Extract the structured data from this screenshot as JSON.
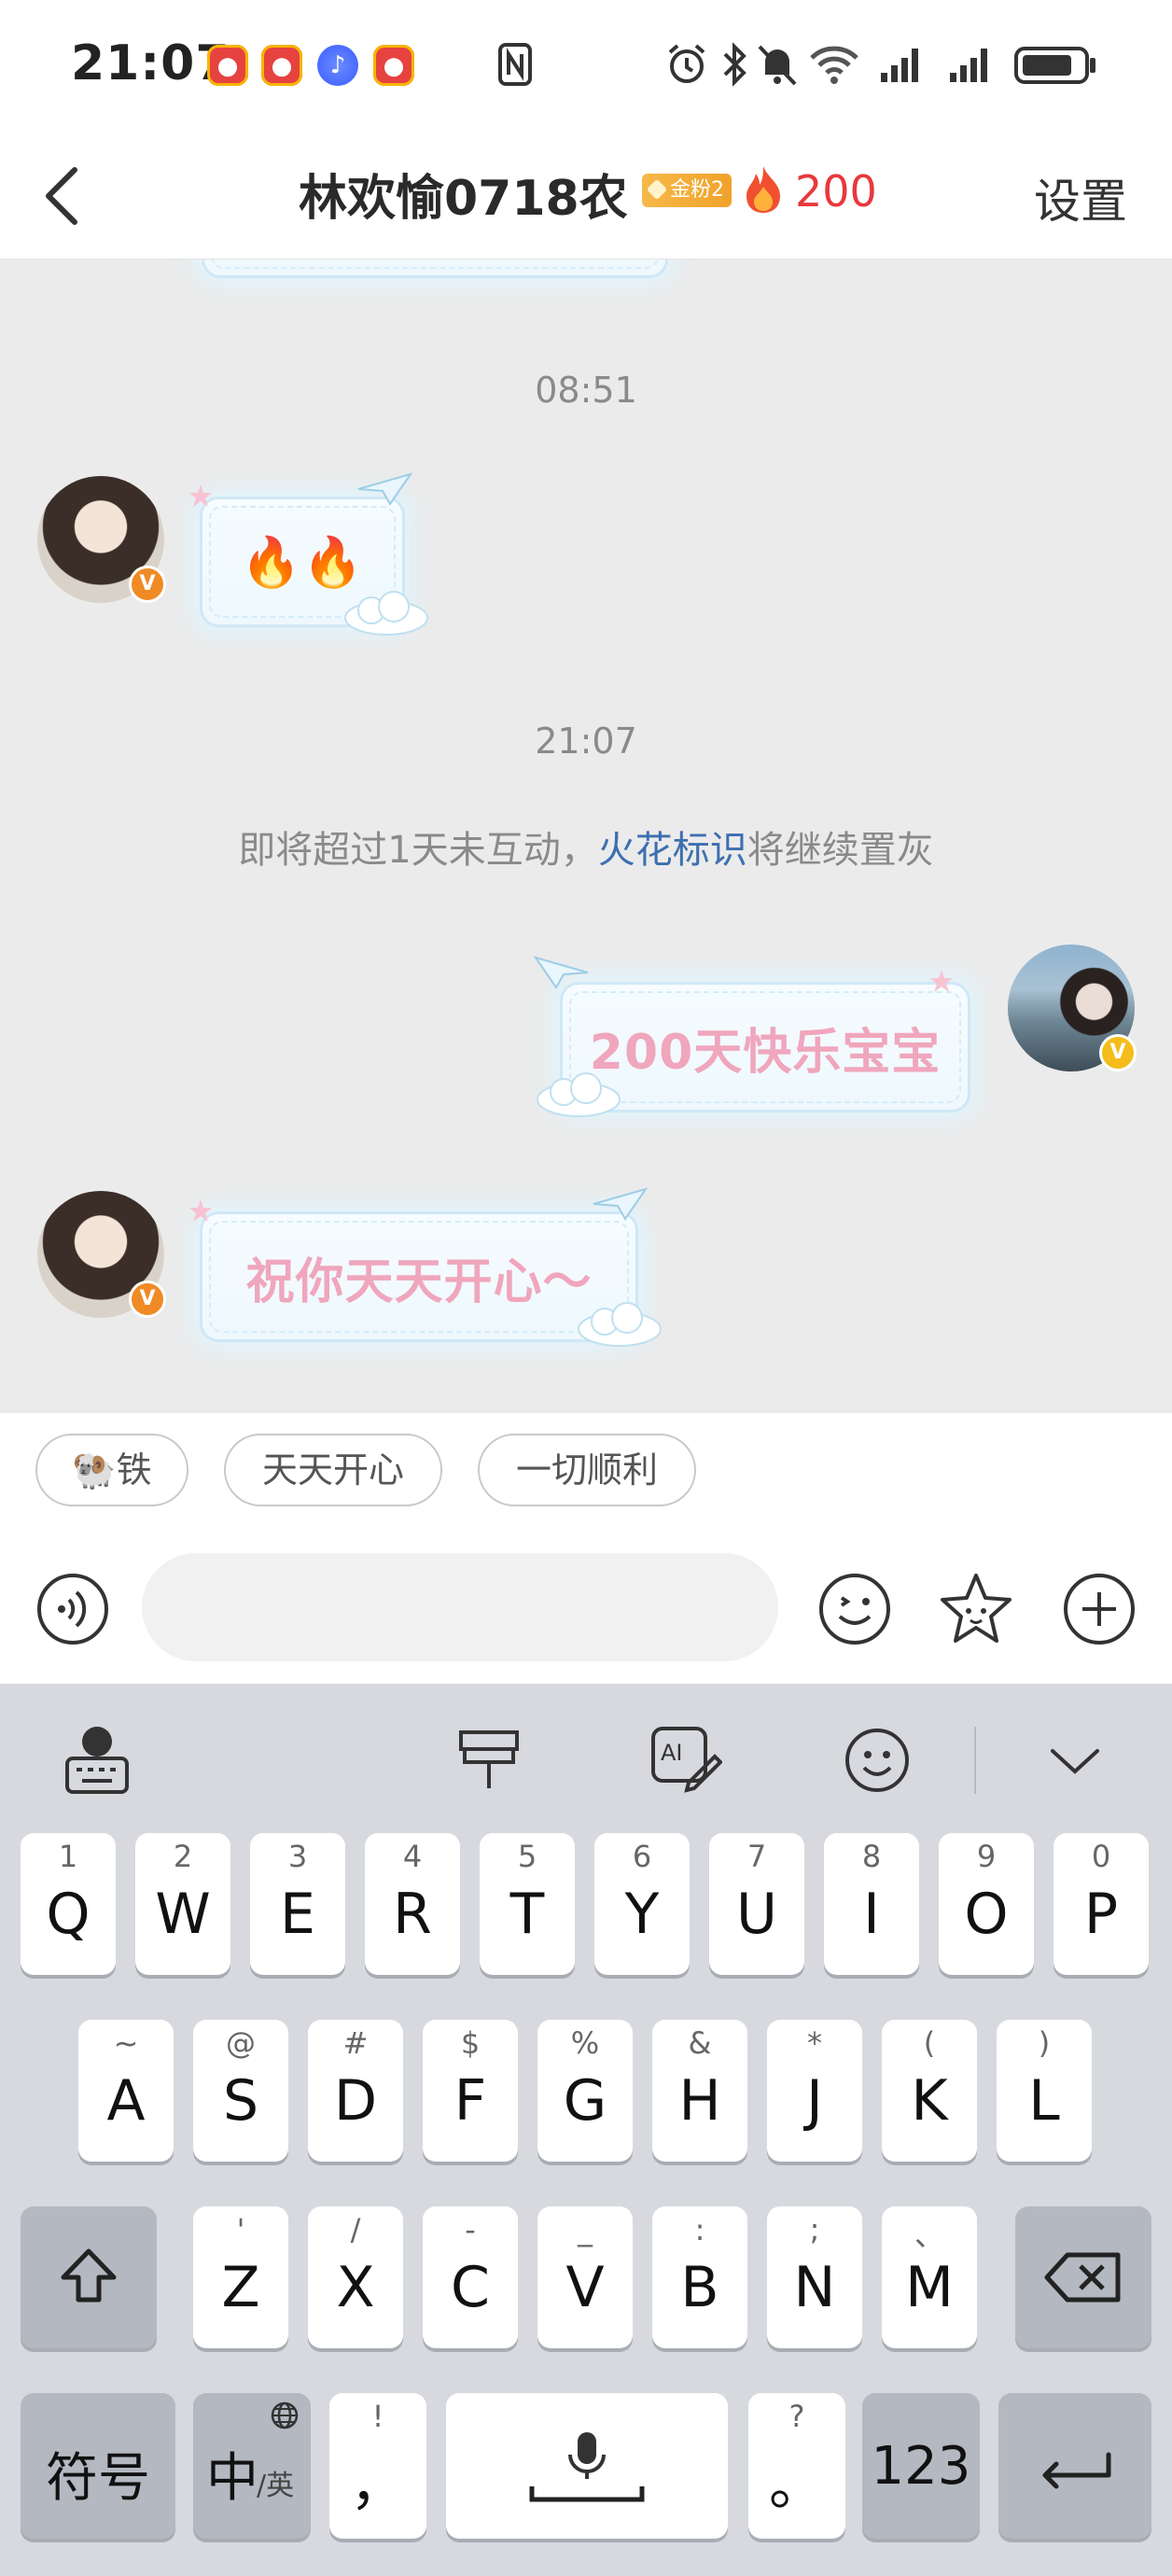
{
  "status_bar": {
    "time": "21:07"
  },
  "header": {
    "title": "林欢愉0718农",
    "fan_badge": "金粉2",
    "spark_count": "200",
    "settings": "设置"
  },
  "chat": {
    "timestamp_1": "08:51",
    "msg_1": "🔥🔥",
    "timestamp_2": "21:07",
    "system_note_prefix": "即将超过1天未互动，",
    "system_note_link": "火花标识",
    "system_note_suffix": "将继续置灰",
    "msg_2": "200天快乐宝宝",
    "msg_3": "祝你天天开心～"
  },
  "quick_replies": [
    "🐏铁",
    "天天开心",
    "一切顺利"
  ],
  "input": {
    "value": "",
    "placeholder": ""
  },
  "keyboard": {
    "row1": [
      {
        "main": "Q",
        "sub": "1"
      },
      {
        "main": "W",
        "sub": "2"
      },
      {
        "main": "E",
        "sub": "3"
      },
      {
        "main": "R",
        "sub": "4"
      },
      {
        "main": "T",
        "sub": "5"
      },
      {
        "main": "Y",
        "sub": "6"
      },
      {
        "main": "U",
        "sub": "7"
      },
      {
        "main": "I",
        "sub": "8"
      },
      {
        "main": "O",
        "sub": "9"
      },
      {
        "main": "P",
        "sub": "0"
      }
    ],
    "row2": [
      {
        "main": "A",
        "sub": "~"
      },
      {
        "main": "S",
        "sub": "@"
      },
      {
        "main": "D",
        "sub": "#"
      },
      {
        "main": "F",
        "sub": "$"
      },
      {
        "main": "G",
        "sub": "%"
      },
      {
        "main": "H",
        "sub": "&"
      },
      {
        "main": "J",
        "sub": "*"
      },
      {
        "main": "K",
        "sub": "("
      },
      {
        "main": "L",
        "sub": ")"
      }
    ],
    "row3": [
      {
        "main": "Z",
        "sub": "'"
      },
      {
        "main": "X",
        "sub": "/"
      },
      {
        "main": "C",
        "sub": "-"
      },
      {
        "main": "V",
        "sub": "_"
      },
      {
        "main": "B",
        "sub": ":"
      },
      {
        "main": "N",
        "sub": ";"
      },
      {
        "main": "M",
        "sub": "、"
      }
    ],
    "symbols_key": "符号",
    "lang_key_main": "中",
    "lang_key_sub": "/英",
    "comma_key": "，",
    "comma_sub": "!",
    "period_key": "。",
    "period_sub": "?",
    "num_key": "123"
  },
  "colors": {
    "accent_red": "#e8383d",
    "link_blue": "#3d6fb0",
    "bubble_text_pink": "#f0a6bd"
  }
}
